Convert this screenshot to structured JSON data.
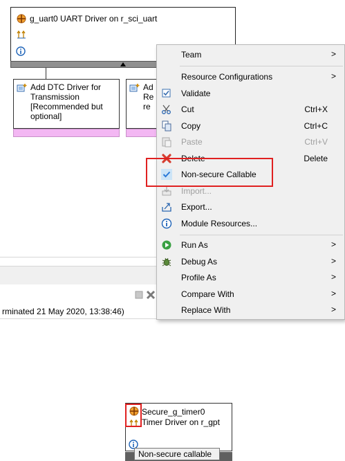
{
  "module": {
    "title": "g_uart0 UART Driver on r_sci_uart"
  },
  "sub_blocks": [
    {
      "label": "Add DTC Driver for Transmission [Recommended but optional]"
    },
    {
      "label_lines": [
        "Ad",
        "Re",
        "re"
      ]
    }
  ],
  "status": {
    "text": "rminated 21 May 2020, 13:38:46)"
  },
  "context_menu": {
    "items": [
      {
        "label": "Team",
        "submenu": true
      },
      {
        "label": "Resource Configurations",
        "submenu": true
      },
      {
        "label": "Validate",
        "icon": "checkbox-icon"
      },
      {
        "label": "Cut",
        "shortcut": "Ctrl+X",
        "icon": "scissors-icon"
      },
      {
        "label": "Copy",
        "shortcut": "Ctrl+C",
        "icon": "copy-icon"
      },
      {
        "label": "Paste",
        "shortcut": "Ctrl+V",
        "icon": "paste-icon",
        "disabled": true
      },
      {
        "label": "Delete",
        "shortcut": "Delete",
        "icon": "delete-x-icon"
      },
      {
        "label": "Non-secure Callable",
        "icon": "checkmark-icon",
        "checked": true
      },
      {
        "label": "Import...",
        "icon": "import-icon",
        "disabled": true
      },
      {
        "label": "Export...",
        "icon": "export-icon"
      },
      {
        "label": "Module Resources...",
        "icon": "info-icon"
      },
      {
        "label": "Run As",
        "submenu": true,
        "icon": "run-icon"
      },
      {
        "label": "Debug As",
        "submenu": true,
        "icon": "debug-bug-icon"
      },
      {
        "label": "Profile As",
        "submenu": true
      },
      {
        "label": "Compare With",
        "submenu": true
      },
      {
        "label": "Replace With",
        "submenu": true
      }
    ],
    "submenu_arrow": ">"
  },
  "timer_block": {
    "line1": "Secure_g_timer0",
    "line2": "Timer Driver on r_gpt"
  },
  "tooltip": {
    "text": "Non-secure callable"
  },
  "colors": {
    "highlight_red": "#e02020",
    "module_bar": "#909090",
    "pink_bar": "#f3b7f3",
    "menu_bg": "#f0f0f0",
    "delete_red": "#d63c2f",
    "check_blue": "#2a79d8"
  }
}
